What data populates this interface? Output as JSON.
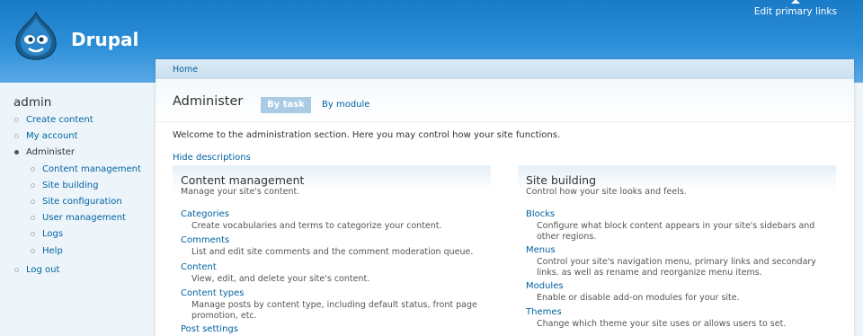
{
  "site": {
    "name": "Drupal",
    "primary_links_label": "Edit primary links"
  },
  "sidebar": {
    "username": "admin",
    "items": [
      {
        "label": "Create content",
        "active": false,
        "level": 1
      },
      {
        "label": "My account",
        "active": false,
        "level": 1
      },
      {
        "label": "Administer",
        "active": true,
        "level": 1
      },
      {
        "label": "Content management",
        "active": false,
        "level": 2
      },
      {
        "label": "Site building",
        "active": false,
        "level": 2
      },
      {
        "label": "Site configuration",
        "active": false,
        "level": 2
      },
      {
        "label": "User management",
        "active": false,
        "level": 2
      },
      {
        "label": "Logs",
        "active": false,
        "level": 2
      },
      {
        "label": "Help",
        "active": false,
        "level": 2
      },
      {
        "label": "Log out",
        "active": false,
        "level": 1
      }
    ]
  },
  "main": {
    "breadcrumb": "Home",
    "title": "Administer",
    "tabs": [
      {
        "label": "By task",
        "active": true
      },
      {
        "label": "By module",
        "active": false
      }
    ],
    "welcome": "Welcome to the administration section. Here you may control how your site functions.",
    "hide_descriptions": "Hide descriptions",
    "sections": [
      {
        "title": "Content management",
        "description": "Manage your site's content.",
        "entries": [
          {
            "title": "Categories",
            "description": "Create vocabularies and terms to categorize your content."
          },
          {
            "title": "Comments",
            "description": "List and edit site comments and the comment moderation queue."
          },
          {
            "title": "Content",
            "description": "View, edit, and delete your site's content."
          },
          {
            "title": "Content types",
            "description": "Manage posts by content type, including default status, front page promotion, etc."
          },
          {
            "title": "Post settings",
            "description": ""
          }
        ]
      },
      {
        "title": "Site building",
        "description": "Control how your site looks and feels.",
        "entries": [
          {
            "title": "Blocks",
            "description": "Configure what block content appears in your site's sidebars and other regions."
          },
          {
            "title": "Menus",
            "description": "Control your site's navigation menu, primary links and secondary links. as well as rename and reorganize menu items."
          },
          {
            "title": "Modules",
            "description": "Enable or disable add-on modules for your site."
          },
          {
            "title": "Themes",
            "description": "Change which theme your site uses or allows users to set."
          }
        ]
      }
    ]
  }
}
